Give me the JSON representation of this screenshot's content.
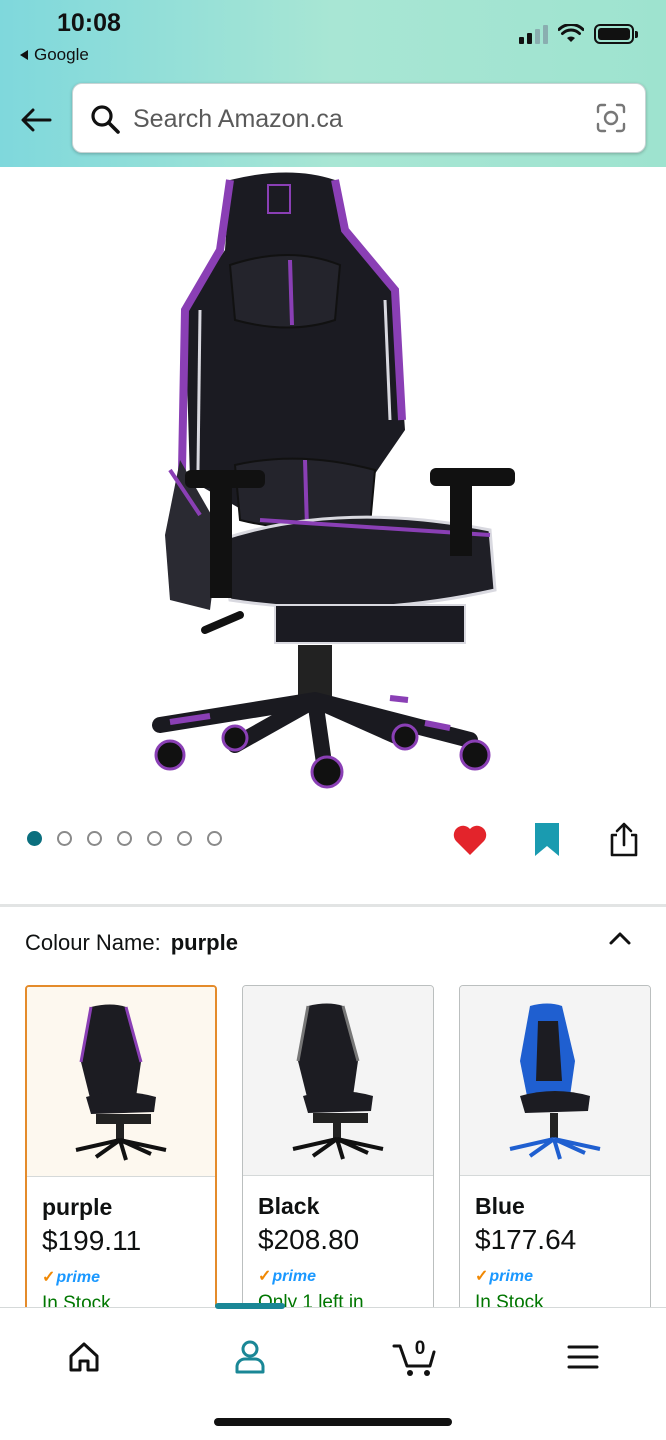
{
  "status_bar": {
    "time": "10:08",
    "back_app": "Google"
  },
  "search": {
    "placeholder": "Search Amazon.ca"
  },
  "icons": {
    "back": "arrow-left-icon",
    "search": "search-icon",
    "camera_lens": "camera-search-icon",
    "favorite": "heart-icon",
    "save": "bookmark-icon",
    "share": "share-icon",
    "collapse": "chevron-up-icon",
    "home": "home-icon",
    "account": "person-icon",
    "cart": "cart-icon",
    "menu": "hamburger-icon"
  },
  "gallery": {
    "image_count": 7,
    "active_index": 0
  },
  "colour": {
    "label": "Colour Name:",
    "selected_value": "purple"
  },
  "variants": [
    {
      "name": "purple",
      "price": "$199.11",
      "prime": "prime",
      "stock": "In Stock",
      "accent": "#7b3fa0"
    },
    {
      "name": "Black",
      "price": "$208.80",
      "prime": "prime",
      "stock": "Only 1 left in",
      "accent": "#333333"
    },
    {
      "name": "Blue",
      "price": "$177.64",
      "prime": "prime",
      "stock": "In Stock",
      "accent": "#1f5fd0"
    }
  ],
  "bottom_nav": {
    "cart_count": "0",
    "active_tab": "account"
  },
  "colors": {
    "accent_teal": "#0b6f7e",
    "heart_red": "#e3242b",
    "bookmark_teal": "#1a9bb0",
    "prime_blue": "#1a98ff",
    "in_stock_green": "#007600",
    "selected_border": "#e48b2b"
  }
}
